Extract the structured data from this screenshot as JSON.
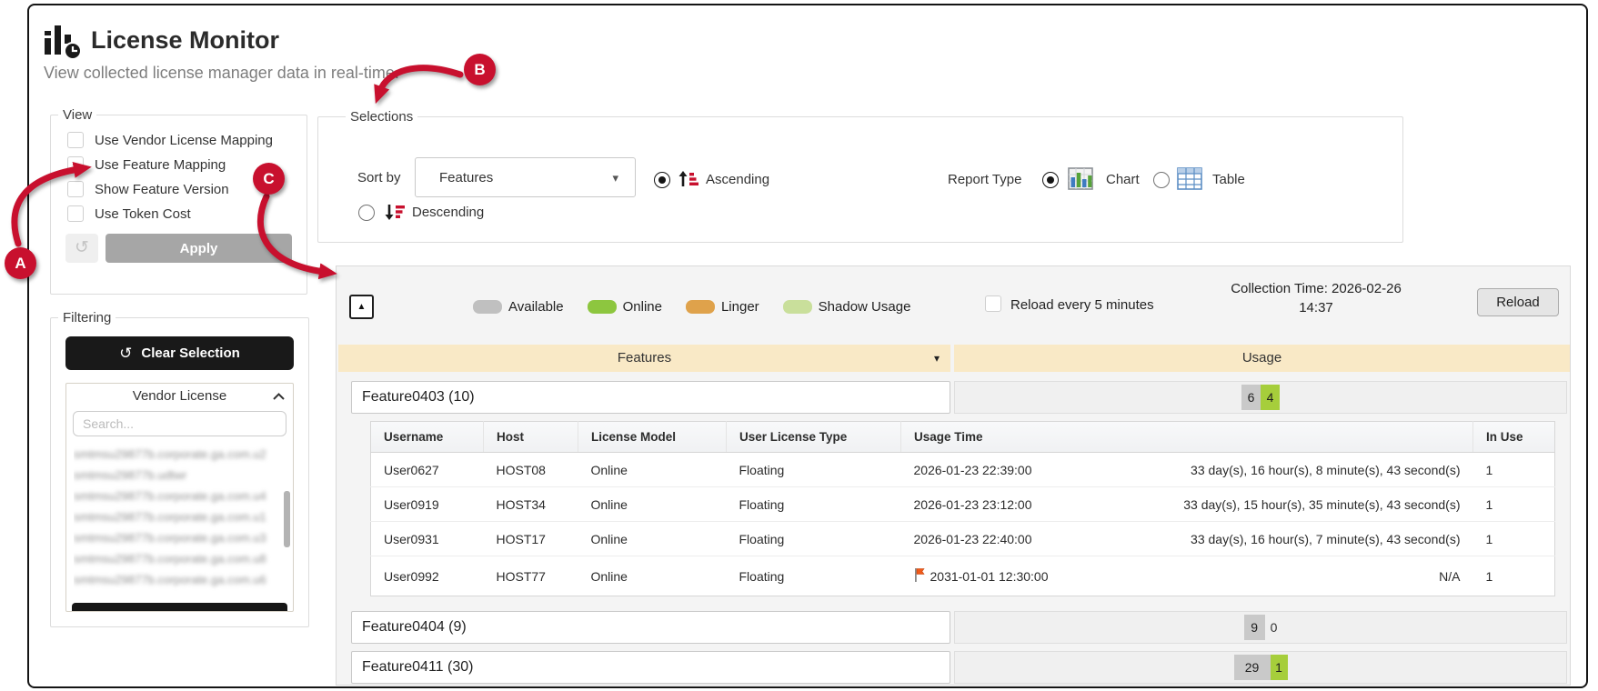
{
  "header": {
    "title": "License Monitor",
    "subtitle": "View collected license manager data in real-time."
  },
  "annotations": {
    "a": "A",
    "b": "B",
    "c": "C"
  },
  "view": {
    "legend": "View",
    "checkboxes": [
      {
        "label": "Use Vendor License Mapping",
        "checked": false
      },
      {
        "label": "Use Feature Mapping",
        "checked": false
      },
      {
        "label": "Show Feature Version",
        "checked": false
      },
      {
        "label": "Use Token Cost",
        "checked": false
      }
    ],
    "undo_icon": "↺",
    "apply_label": "Apply"
  },
  "filtering": {
    "legend": "Filtering",
    "clear_icon": "↺",
    "clear_label": "Clear Selection",
    "vendor": {
      "title": "Vendor License",
      "search_placeholder": "Search...",
      "items": [
        "smtmsu29877b.corporate.ga.com.u2",
        "smtmsu29877b.udtwr",
        "smtmsu29877b.corporate.ga.com.u4",
        "smtmsu29877b.corporate.ga.com.u1",
        "smtmsu29877b.corporate.ga.com.u3",
        "smtmsu29877b.corporate.ga.com.u8",
        "smtmsu29877b.corporate.ga.com.u6"
      ]
    }
  },
  "selections": {
    "legend": "Selections",
    "sort_by_label": "Sort by",
    "sort_value": "Features",
    "sort_caret": "▾",
    "ascending_label": "Ascending",
    "descending_label": "Descending",
    "sort_direction": "ascending",
    "report_type_label": "Report Type",
    "chart_label": "Chart",
    "table_label": "Table",
    "report_type": "chart"
  },
  "monitor": {
    "collapse_icon": "▲",
    "legend": [
      {
        "label": "Available",
        "color": "#c0c0c0"
      },
      {
        "label": "Online",
        "color": "#8dc63f"
      },
      {
        "label": "Linger",
        "color": "#dfa24b"
      },
      {
        "label": "Shadow Usage",
        "color": "#c9df9b"
      }
    ],
    "reload_every_label": "Reload every 5 minutes",
    "reload_every_checked": false,
    "collection_time_line1": "Collection Time: 2026-02-26",
    "collection_time_line2": "14:37",
    "reload_label": "Reload",
    "columns": {
      "features": "Features",
      "usage": "Usage",
      "features_caret": "▾"
    },
    "user_table_headers": [
      "Username",
      "Host",
      "License Model",
      "User License Type",
      "Usage Time",
      "In Use"
    ],
    "features": [
      {
        "name": "Feature0403 (10)",
        "available": 6,
        "online": 4,
        "users": [
          {
            "username": "User0627",
            "host": "HOST08",
            "license_model": "Online",
            "user_license_type": "Floating",
            "usage_time": "2026-01-23 22:39:00",
            "duration": "33 day(s), 16 hour(s), 8 minute(s), 43 second(s)",
            "in_use": "1",
            "flagged": false
          },
          {
            "username": "User0919",
            "host": "HOST34",
            "license_model": "Online",
            "user_license_type": "Floating",
            "usage_time": "2026-01-23 23:12:00",
            "duration": "33 day(s), 15 hour(s), 35 minute(s), 43 second(s)",
            "in_use": "1",
            "flagged": false
          },
          {
            "username": "User0931",
            "host": "HOST17",
            "license_model": "Online",
            "user_license_type": "Floating",
            "usage_time": "2026-01-23 22:40:00",
            "duration": "33 day(s), 16 hour(s), 7 minute(s), 43 second(s)",
            "in_use": "1",
            "flagged": false
          },
          {
            "username": "User0992",
            "host": "HOST77",
            "license_model": "Online",
            "user_license_type": "Floating",
            "usage_time": "2031-01-01 12:30:00",
            "duration": "N/A",
            "in_use": "1",
            "flagged": true
          }
        ]
      },
      {
        "name": "Feature0404 (9)",
        "available": 9,
        "online": 0
      },
      {
        "name": "Feature0411 (30)",
        "available": 29,
        "online": 1
      }
    ]
  }
}
